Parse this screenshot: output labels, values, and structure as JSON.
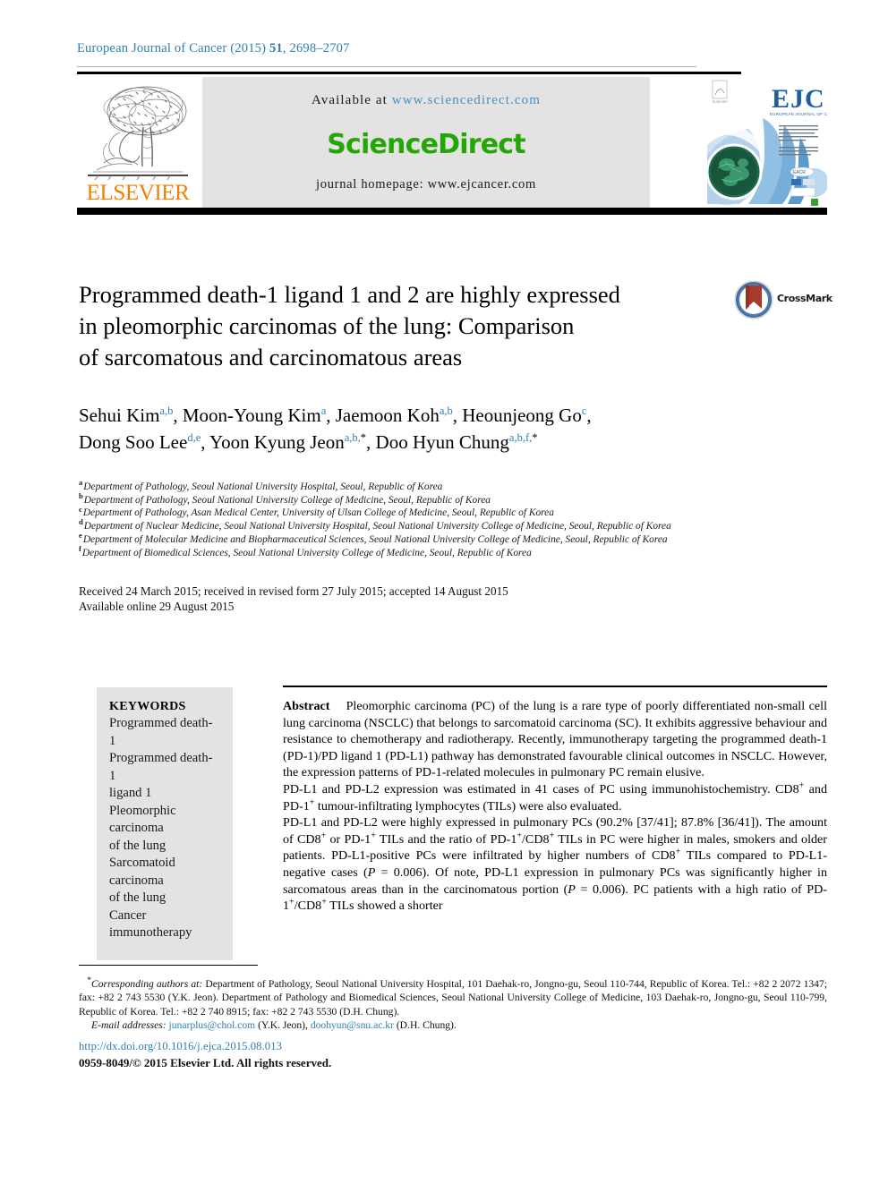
{
  "journal": {
    "running_head_prefix": "European Journal of Cancer (2015) ",
    "running_head_volume": "51",
    "running_head_pages": ", 2698–2707"
  },
  "masthead": {
    "publisher_name": "ELSEVIER",
    "available_label": "Available at ",
    "available_url": "www.sciencedirect.com",
    "sciencedirect_logo": "ScienceDirect",
    "homepage_label": "journal homepage: www.ejcancer.com",
    "cover_title": "EJC",
    "cover_subtitle": "EUROPEAN JOURNAL OF CANCER"
  },
  "article": {
    "title_line1": "Programmed death-1 ligand 1 and 2 are highly expressed",
    "title_line2": "in pleomorphic carcinomas of the lung: Comparison",
    "title_line3": "of sarcomatous and carcinomatous areas",
    "crossmark_label": "CrossMark"
  },
  "authors": {
    "line1": [
      {
        "name": "Sehui Kim",
        "marks": "a,b",
        "sep": ", "
      },
      {
        "name": "Moon-Young Kim",
        "marks": "a",
        "sep": ", "
      },
      {
        "name": "Jaemoon Koh",
        "marks": "a,b",
        "sep": ", "
      },
      {
        "name": "Heounjeong Go",
        "marks": "c",
        "sep": ","
      }
    ],
    "line2": [
      {
        "name": "Dong Soo Lee",
        "marks": "d,e",
        "sep": ", "
      },
      {
        "name": "Yoon Kyung Jeon",
        "marks": "a,b,",
        "star": "*",
        "sep": ", "
      },
      {
        "name": "Doo Hyun Chung",
        "marks": "a,b,f,",
        "star": "*",
        "sep": ""
      }
    ]
  },
  "affiliations": [
    {
      "mark": "a",
      "text": "Department of Pathology, Seoul National University Hospital, Seoul, Republic of Korea"
    },
    {
      "mark": "b",
      "text": "Department of Pathology, Seoul National University College of Medicine, Seoul, Republic of Korea"
    },
    {
      "mark": "c",
      "text": "Department of Pathology, Asan Medical Center, University of Ulsan College of Medicine, Seoul, Republic of Korea"
    },
    {
      "mark": "d",
      "text": "Department of Nuclear Medicine, Seoul National University Hospital, Seoul National University College of Medicine, Seoul, Republic of Korea"
    },
    {
      "mark": "e",
      "text": "Department of Molecular Medicine and Biopharmaceutical Sciences, Seoul National University College of Medicine, Seoul, Republic of Korea"
    },
    {
      "mark": "f",
      "text": "Department of Biomedical Sciences, Seoul National University College of Medicine, Seoul, Republic of Korea"
    }
  ],
  "history": {
    "line1": "Received 24 March 2015; received in revised form 27 July 2015; accepted 14 August 2015",
    "line2": "Available online 29 August 2015"
  },
  "keywords": {
    "heading": "KEYWORDS",
    "items": [
      "Programmed death-1",
      "Programmed death-1",
      "ligand 1",
      "Pleomorphic carcinoma",
      "of the lung",
      "Sarcomatoid carcinoma",
      "of the lung",
      "Cancer immunotherapy"
    ]
  },
  "abstract": {
    "label": "Abstract",
    "para1": "Pleomorphic carcinoma (PC) of the lung is a rare type of poorly differentiated non-small cell lung carcinoma (NSCLC) that belongs to sarcomatoid carcinoma (SC). It exhibits aggressive behaviour and resistance to chemotherapy and radiotherapy. Recently, immunotherapy targeting the programmed death-1 (PD-1)/PD ligand 1 (PD-L1) pathway has demonstrated favourable clinical outcomes in NSCLC. However, the expression patterns of PD-1-related molecules in pulmonary PC remain elusive.",
    "para2_a": "PD-L1 and PD-L2 expression was estimated in 41 cases of PC using immunohistochemistry. CD8",
    "para2_sup1": "+",
    "para2_b": " and PD-1",
    "para2_sup2": "+",
    "para2_c": " tumour-infiltrating lymphocytes (TILs) were also evaluated.",
    "para3_a": "PD-L1 and PD-L2 were highly expressed in pulmonary PCs (90.2% [37/41]; 87.8% [36/41]). The amount of CD8",
    "para3_sup1": "+",
    "para3_b": " or PD-1",
    "para3_sup2": "+",
    "para3_c": " TILs and the ratio of PD-1",
    "para3_sup3": "+",
    "para3_d": "/CD8",
    "para3_sup4": "+",
    "para3_e": " TILs in PC were higher in males, smokers and older patients. PD-L1-positive PCs were infiltrated by higher numbers of CD8",
    "para3_sup5": "+",
    "para3_f": " TILs compared to PD-L1-negative cases (",
    "para3_p1_italic": "P",
    "para3_g": " = 0.006). Of note, PD-L1 expression in pulmonary PCs was significantly higher in sarcomatous areas than in the carcinomatous portion (",
    "para3_p2_italic": "P",
    "para3_h": " = 0.006). PC patients with a high ratio of PD-1",
    "para3_sup6": "+",
    "para3_i": "/CD8",
    "para3_sup7": "+",
    "para3_j": " TILs showed a shorter"
  },
  "footnote": {
    "star": "*",
    "corresponding_italic": "Corresponding authors at:",
    "corresponding_text": " Department of Pathology, Seoul National University Hospital, 101 Daehak-ro, Jongno-gu, Seoul 110-744, Republic of Korea. Tel.: +82 2 2072 1347; fax: +82 2 743 5530 (Y.K. Jeon). Department of Pathology and Biomedical Sciences, Seoul National University College of Medicine, 103 Daehak-ro, Jongno-gu, Seoul 110-799, Republic of Korea. Tel.: +82 2 740 8915; fax: +82 2 743 5530 (D.H. Chung).",
    "email_label": "E-mail addresses:",
    "email1": "junarplus@chol.com",
    "email1_owner": " (Y.K. Jeon), ",
    "email2": "doohyun@snu.ac.kr",
    "email2_owner": " (D.H. Chung)."
  },
  "doi": "http://dx.doi.org/10.1016/j.ejca.2015.08.013",
  "copyright": "0959-8049/© 2015 Elsevier Ltd. All rights reserved.",
  "colors": {
    "journal_blue": "#2e7fb0",
    "elsevier_orange": "#f08000",
    "sciencedirect_green": "#23a606",
    "keywords_bg": "#e3e3e3",
    "crossmark_red": "#a83a2a",
    "crossmark_blue": "#3f6d9e"
  }
}
